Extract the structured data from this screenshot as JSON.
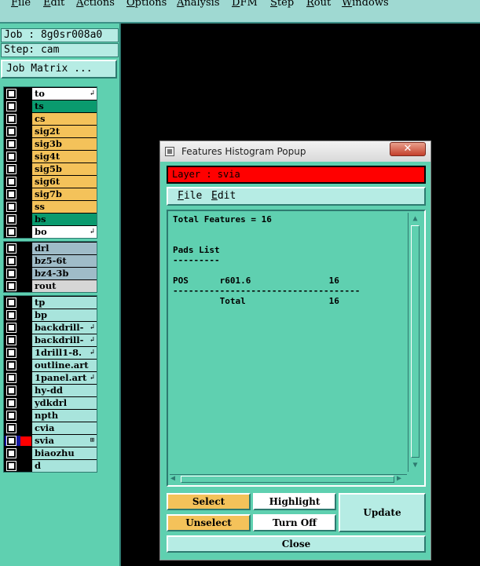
{
  "menubar": {
    "items": [
      "File",
      "Edit",
      "Actions",
      "Options",
      "Analysis",
      "DFM",
      "Step",
      "Rout",
      "Windows"
    ]
  },
  "left_panel": {
    "job": "Job : 8g0sr008a0",
    "step": "Step: cam",
    "job_matrix": "Job Matrix ..."
  },
  "layers": {
    "group1": [
      {
        "name": "to",
        "color": "#ffffff",
        "marker": "↲"
      },
      {
        "name": "ts",
        "color": "#0a9a6e",
        "marker": ""
      },
      {
        "name": "cs",
        "color": "#f4c25a",
        "marker": ""
      },
      {
        "name": "sig2t",
        "color": "#f4c25a",
        "marker": ""
      },
      {
        "name": "sig3b",
        "color": "#f4c25a",
        "marker": ""
      },
      {
        "name": "sig4t",
        "color": "#f4c25a",
        "marker": ""
      },
      {
        "name": "sig5b",
        "color": "#f4c25a",
        "marker": ""
      },
      {
        "name": "sig6t",
        "color": "#f4c25a",
        "marker": ""
      },
      {
        "name": "sig7b",
        "color": "#f4c25a",
        "marker": ""
      },
      {
        "name": "ss",
        "color": "#f4c25a",
        "marker": ""
      },
      {
        "name": "bs",
        "color": "#0a9a6e",
        "marker": ""
      },
      {
        "name": "bo",
        "color": "#ffffff",
        "marker": "↲"
      }
    ],
    "group2": [
      {
        "name": "drl",
        "color": "#9fbcc8",
        "marker": ""
      },
      {
        "name": "bz5-6t",
        "color": "#9fbcc8",
        "marker": ""
      },
      {
        "name": "bz4-3b",
        "color": "#9fbcc8",
        "marker": ""
      },
      {
        "name": "rout",
        "color": "#d6d6d6",
        "marker": ""
      }
    ],
    "group3": [
      {
        "name": "tp",
        "color": "#a8e4dc",
        "marker": "",
        "selected": false
      },
      {
        "name": "bp",
        "color": "#a8e4dc",
        "marker": "",
        "selected": false
      },
      {
        "name": "backdrill-",
        "color": "#a8e4dc",
        "marker": "↲",
        "selected": false
      },
      {
        "name": "backdrill-",
        "color": "#a8e4dc",
        "marker": "↲",
        "selected": false
      },
      {
        "name": "1drill1-8.",
        "color": "#a8e4dc",
        "marker": "↲",
        "selected": false
      },
      {
        "name": "outline.art",
        "color": "#a8e4dc",
        "marker": "",
        "selected": false
      },
      {
        "name": "1panel.art",
        "color": "#a8e4dc",
        "marker": "↲",
        "selected": false
      },
      {
        "name": "hy-dd",
        "color": "#a8e4dc",
        "marker": "",
        "selected": false
      },
      {
        "name": "ydkdrl",
        "color": "#a8e4dc",
        "marker": "",
        "selected": false
      },
      {
        "name": "npth",
        "color": "#a8e4dc",
        "marker": "",
        "selected": false
      },
      {
        "name": "cvia",
        "color": "#a8e4dc",
        "marker": "",
        "selected": false
      },
      {
        "name": "svia",
        "color": "#a8e4dc",
        "marker": "⊞",
        "selected": true
      },
      {
        "name": "biaozhu",
        "color": "#a8e4dc",
        "marker": "",
        "selected": false
      },
      {
        "name": "d",
        "color": "#a8e4dc",
        "marker": "",
        "selected": false
      }
    ]
  },
  "popup": {
    "title": "Features Histogram Popup",
    "close_glyph": "✕",
    "layer_label": "Layer :  svia",
    "menu": [
      "File",
      "Edit"
    ],
    "lines": [
      "Total Features = 16",
      "",
      "",
      "Pads List",
      "---------",
      "",
      "POS      r601.6               16",
      "------------------------------------",
      "         Total                16"
    ],
    "buttons": {
      "select": "Select",
      "highlight": "Highlight",
      "update": "Update",
      "unselect": "Unselect",
      "turn_off": "Turn Off",
      "close": "Close"
    }
  },
  "colors": {
    "panel_teal": "#5fd0b0",
    "light_teal": "#b6ece4",
    "layer_red": "#ff0000",
    "button_yellow": "#f4c25a",
    "selected_swatch": "#ff0000"
  }
}
